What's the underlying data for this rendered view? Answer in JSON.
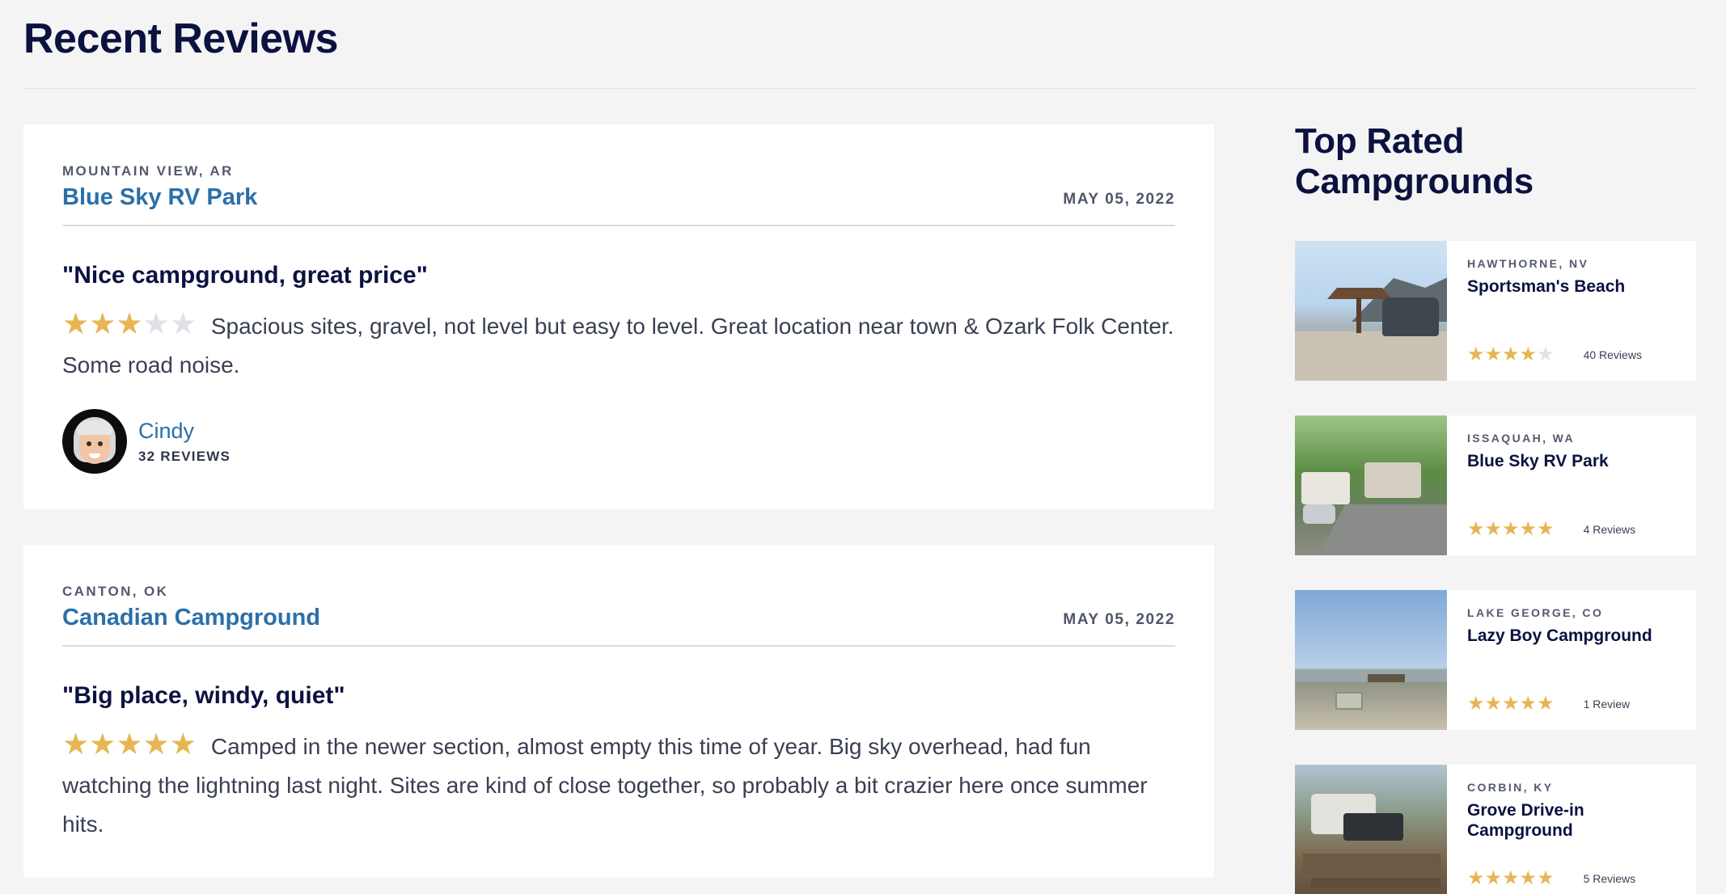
{
  "page": {
    "title": "Recent Reviews"
  },
  "reviews": [
    {
      "location": "MOUNTAIN VIEW, AR",
      "campground": "Blue Sky RV Park",
      "date": "MAY 05, 2022",
      "title": "\"Nice campground, great price\"",
      "rating": 3,
      "body": "Spacious sites, gravel, not level but easy to level. Great location near town & Ozark Folk Center. Some road noise.",
      "author": {
        "name": "Cindy",
        "review_count": "32 REVIEWS"
      }
    },
    {
      "location": "CANTON, OK",
      "campground": "Canadian Campground",
      "date": "MAY 05, 2022",
      "title": "\"Big place, windy, quiet\"",
      "rating": 5,
      "body": "Camped in the newer section, almost empty this time of year. Big sky overhead, had fun watching the lightning last night. Sites are kind of close together, so probably a bit crazier here once summer hits."
    }
  ],
  "sidebar": {
    "title": "Top Rated Campgrounds",
    "campgrounds": [
      {
        "location": "HAWTHORNE, NV",
        "name": "Sportsman's Beach",
        "rating": 4,
        "reviews": "40 Reviews"
      },
      {
        "location": "ISSAQUAH, WA",
        "name": "Blue Sky RV Park",
        "rating": 5,
        "reviews": "4 Reviews"
      },
      {
        "location": "LAKE GEORGE, CO",
        "name": "Lazy Boy Campground",
        "rating": 5,
        "reviews": "1 Review"
      },
      {
        "location": "CORBIN, KY",
        "name": "Grove Drive-in Campground",
        "rating": 5,
        "reviews": "5 Reviews"
      }
    ]
  },
  "icons": {
    "star": "star-icon",
    "avatar": "memoji-avatar"
  },
  "colors": {
    "star_on": "#e8b553",
    "star_off": "#dfe1e6",
    "link": "#2c6fa8",
    "heading": "#0b1240"
  }
}
